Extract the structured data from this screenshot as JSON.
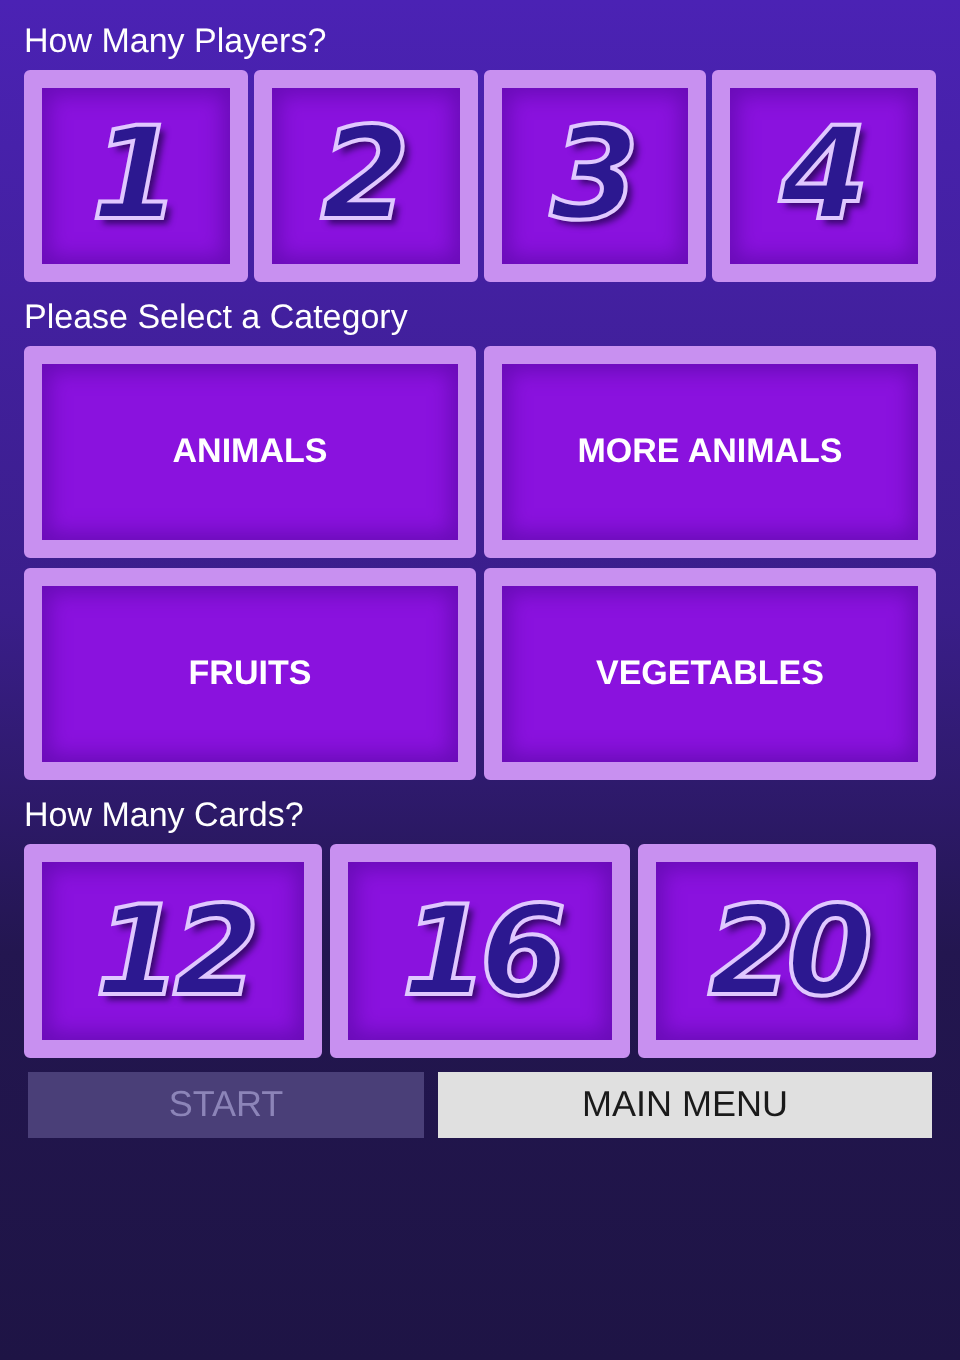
{
  "players": {
    "heading": "How Many Players?",
    "options": [
      "1",
      "2",
      "3",
      "4"
    ]
  },
  "category": {
    "heading": "Please Select a Category",
    "options": [
      "ANIMALS",
      "MORE ANIMALS",
      "FRUITS",
      "VEGETABLES"
    ]
  },
  "cards": {
    "heading": "How Many Cards?",
    "options": [
      "12",
      "16",
      "20"
    ]
  },
  "buttons": [
    {
      "kind": "start",
      "label": "START",
      "disabled": true
    },
    {
      "kind": "menu",
      "label": "MAIN MENU",
      "disabled": false
    }
  ]
}
